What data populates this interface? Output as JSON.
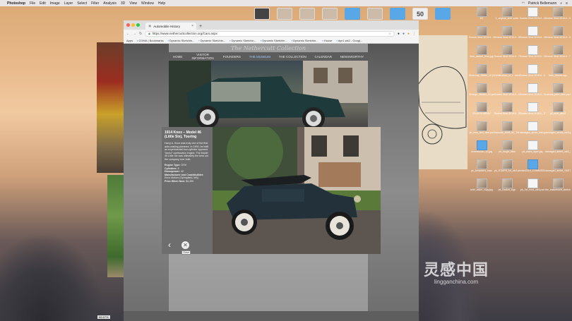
{
  "menubar": {
    "app": "Photoshop",
    "items": [
      "File",
      "Edit",
      "Image",
      "Layer",
      "Select",
      "Filter",
      "Analysis",
      "3D",
      "View",
      "Window",
      "Help"
    ],
    "right_user": "Patrick Bellemann"
  },
  "browser": {
    "tab_title": "Automobile History",
    "url": "https://www.nethercuttcollection.org/Cars.aspx",
    "bookmarks": [
      "Apps",
      "CGMA | Bookmarks",
      "Dynamic Sketchin...",
      "Dynamic Sketchin...",
      "Dynamic Sketchin...",
      "Dynamic Sketchin...",
      "Dynamic Sketchin...",
      "House",
      "dyn1 wk2 - Googl..."
    ]
  },
  "site": {
    "logo": "The Nethercutt Collection",
    "nav": [
      "HOME",
      "VISITOR INFORMATION",
      "FOUNDERS",
      "THE MUSEUM",
      "THE COLLECTION",
      "CALENDAR",
      "NEWSWORTHY"
    ]
  },
  "car": {
    "title": "1914 Knox – Model 46 (Little Six), Touring",
    "description": "Harry A. Knox was truly one of the first auto-making pioneers. In 1900, he built an experimental four-cylinder opposed “domo” combustion engine. The Model 46 Little Six was ultimately the best car the company ever built.",
    "specs": [
      {
        "label": "Engine Type:",
        "value": "OHV"
      },
      {
        "label": "Cylinders:",
        "value": "6"
      },
      {
        "label": "Horsepower:",
        "value": "40"
      },
      {
        "label": "Manufacturer and Coachbuilder:",
        "value": "Knox Motors (Springfield, MA)"
      },
      {
        "label": "Price When New:",
        "value": "$4,350"
      }
    ],
    "close_tooltip": "Close"
  },
  "desktop": {
    "top_icon_label": "50",
    "files": [
      "H2",
      "1_original_shirt order",
      "Screen Shot 2019-0...3.22 PM",
      "Screen Shot 2019-0...3.23 AM",
      "Screen Shot 2019-0...3.24 PM",
      "Screen Shot 2019-0...3.26 PM",
      "Screen Shot 2019-0...3.10 AM",
      "Screen Shot 2019-0...3.11 PM",
      "thee_sketch_front.jpg",
      "Screen Shot 2019-0...7.22 AM",
      "Screen Shot 2019-0...3.17 PM",
      "Screen Shot 2019-0...7.20 AM",
      "Sketchup_Sticke_19 (4).png",
      "Certification_of_f...ence.pdf",
      "Screen Shot 2019-0...3.57 PM",
      "fubu_StreetLogo",
      "Strange_Sticker_20.psd",
      "Screen Shot 2019-0...1.51 PM",
      "Screen Shot 2019-0...3.04 PM",
      "canvas_print_ratio.psd",
      "EGG679 MENU",
      "Screen Shot 2019-0...3.14 PM",
      "Screen Shot 2019-0...3.21 PM",
      "pk_shirt_wk02",
      "pk_man_feel_new.psd",
      "barcode_4063_99_TM...003.pdf",
      "damaged_street_wk3.jpg",
      "damaged_levels_wk3.jpg",
      "commission_15.jpg",
      "pk_rough_idea",
      "pk_stairs_layer.jpg",
      "damaged_street_wk3_2.jpg",
      "pk_forrackers_barc",
      "pk_STAIRS_for_wk3.psd",
      "enter2019_COMMISSIO",
      "damaged_street_SKETCH",
      "shirt_value_copy.jpg",
      "pk_Basket_sign",
      "pk_1st_rnnd_wk3.psd",
      "the_basketshirt_sketch"
    ]
  },
  "status": {
    "zoom": "66.67%"
  },
  "watermark": {
    "brand": "灵感中国",
    "site": "lingganchina.com"
  },
  "colors": {
    "page_bg": "#7a7a7a",
    "info_panel": "#6e6e6e",
    "menubar": "#e9e4e6"
  }
}
